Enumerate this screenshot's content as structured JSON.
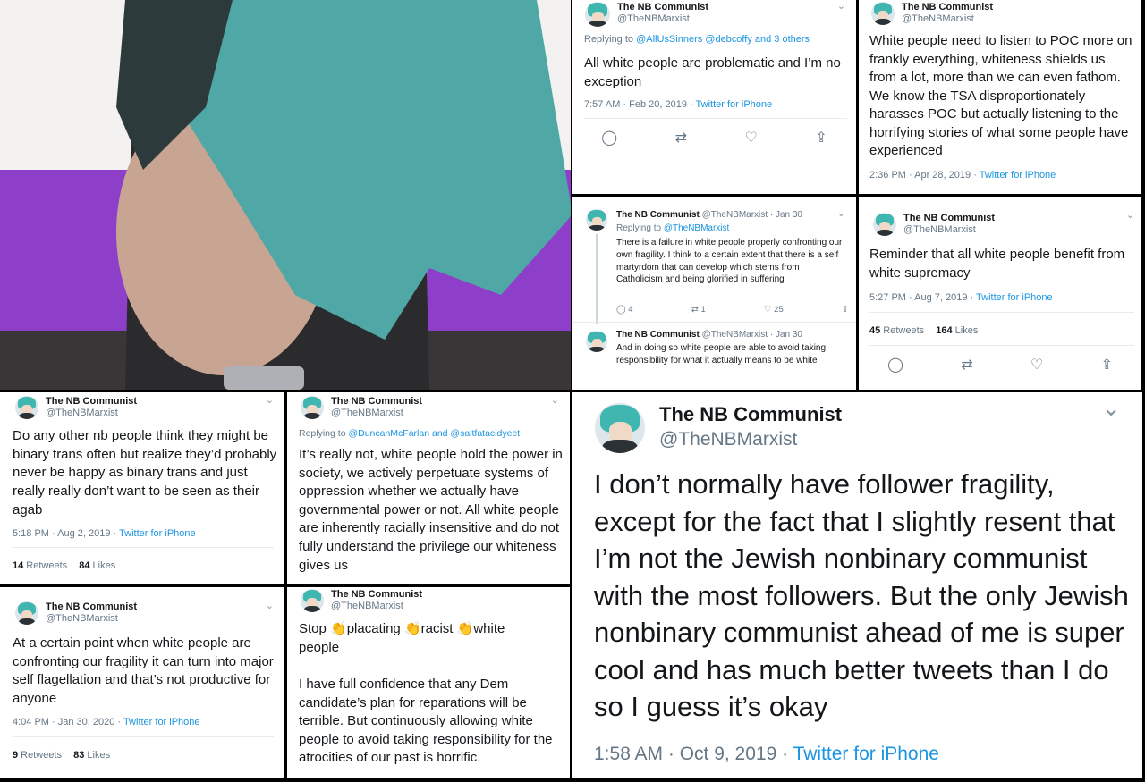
{
  "profile": {
    "name": "The NB Communist",
    "handle": "@TheNBMarxist"
  },
  "tweets": {
    "t1": {
      "reply_prefix": "Replying to ",
      "reply_to": "@AllUsSinners @debcoffy and 3 others",
      "text": "All white people are problematic and I’m no exception",
      "time": "7:57 AM · Feb 20, 2019 · ",
      "source": "Twitter for iPhone"
    },
    "t2": {
      "text": "White people need to listen to POC more on frankly everything, whiteness shields us from a lot, more than we can even fathom. We know the TSA disproportionately harasses POC but actually listening to the horrifying stories of what some people have experienced",
      "time": "2:36 PM · Apr 28, 2019 · ",
      "source": "Twitter for iPhone"
    },
    "t3": {
      "name_meta": "@TheNBMarxist · Jan 30",
      "reply_prefix": "Replying to ",
      "reply_to": "@TheNBMarxist",
      "text": "There is a failure in white people properly confronting our own fragility. I think to a certain extent that there is a self martyrdom that can develop which stems from Catholicism and being glorified in suffering",
      "replies": "4",
      "retweets": "1",
      "likes": "25",
      "text2_meta": "@TheNBMarxist · Jan 30",
      "text2": "And in doing so white people are able to avoid taking responsibility for what it actually means to be white"
    },
    "t4": {
      "text": "Reminder that all white people benefit from white supremacy",
      "time": "5:27 PM · Aug 7, 2019 · ",
      "source": "Twitter for iPhone",
      "retweets": "45",
      "retweets_label": " Retweets",
      "likes": "164",
      "likes_label": " Likes"
    },
    "t5": {
      "text": "Do any other nb people think they might be binary trans often but realize they’d probably never be happy as binary trans and just really really don’t want to be seen as their agab",
      "time": "5:18 PM · Aug 2, 2019 · ",
      "source": "Twitter for iPhone",
      "retweets": "14",
      "retweets_label": " Retweets",
      "likes": "84",
      "likes_label": " Likes"
    },
    "t6": {
      "reply_prefix": "Replying to ",
      "reply_to": "@DuncanMcFarlan and @saltfatacidyeet",
      "text": "It’s really not, white people hold the power in society, we actively perpetuate systems of oppression whether we actually have governmental power or not. All white people are inherently racially insensitive and do not fully understand the privilege our whiteness gives us"
    },
    "t7": {
      "text": "I don’t normally have follower fragility, except for the fact that I slightly resent that I’m not the Jewish nonbinary communist with the most followers. But the only Jewish nonbinary communist ahead of me is super cool and has much better tweets than I do so I guess it’s okay",
      "time": "1:58 AM · Oct 9, 2019 · ",
      "source": "Twitter for iPhone"
    },
    "t8": {
      "text": "At a certain point when white people are confronting our fragility it can turn into major self flagellation and that’s not productive for anyone",
      "time": "4:04 PM · Jan 30, 2020 · ",
      "source": "Twitter for iPhone",
      "retweets": "9",
      "retweets_label": " Retweets",
      "likes": "83",
      "likes_label": " Likes"
    },
    "t9": {
      "w1": "Stop ",
      "w2": "placating ",
      "w3": "racist ",
      "w4": "white",
      "w5": "people",
      "text": "I have full confidence that any Dem candidate’s plan for reparations will be terrible. But continuously allowing white people to avoid taking responsibility for the atrocities of our past is horrific."
    }
  },
  "icons": {
    "reply": "reply-icon",
    "retweet": "retweet-icon",
    "like": "heart-icon",
    "share": "share-icon",
    "chevron": "chevron-down-icon",
    "clap": "clapping-hands-icon"
  },
  "colors": {
    "link": "#1b95e0",
    "muted": "#657786",
    "hair": "#3fb7b0",
    "clap": "#f4b324"
  }
}
